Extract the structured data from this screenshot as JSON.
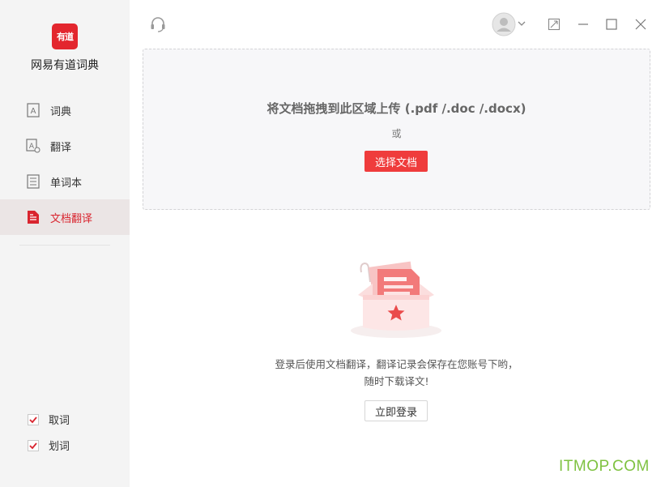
{
  "app": {
    "logo_text": "有道",
    "name": "网易有道词典"
  },
  "sidebar": {
    "items": [
      {
        "label": "词典",
        "icon": "dictionary-icon",
        "active": false
      },
      {
        "label": "翻译",
        "icon": "translate-icon",
        "active": false
      },
      {
        "label": "单词本",
        "icon": "wordbook-icon",
        "active": false
      },
      {
        "label": "文档翻译",
        "icon": "document-icon",
        "active": true
      }
    ],
    "options": [
      {
        "label": "取词",
        "checked": true
      },
      {
        "label": "划词",
        "checked": true
      }
    ]
  },
  "dropzone": {
    "title": "将文档拖拽到此区域上传 (.pdf /.doc /.docx)",
    "or_text": "或",
    "choose_label": "选择文档"
  },
  "main": {
    "message_line1": "登录后使用文档翻译，翻译记录会保存在您账号下哟，",
    "message_line2": "随时下载译文!",
    "login_label": "立即登录"
  },
  "watermark": "ITMOP.COM",
  "colors": {
    "accent": "#e3262e",
    "button_red": "#ef3c3c",
    "sidebar_bg": "#f4f4f4",
    "active_bg": "#ebe5e5"
  }
}
